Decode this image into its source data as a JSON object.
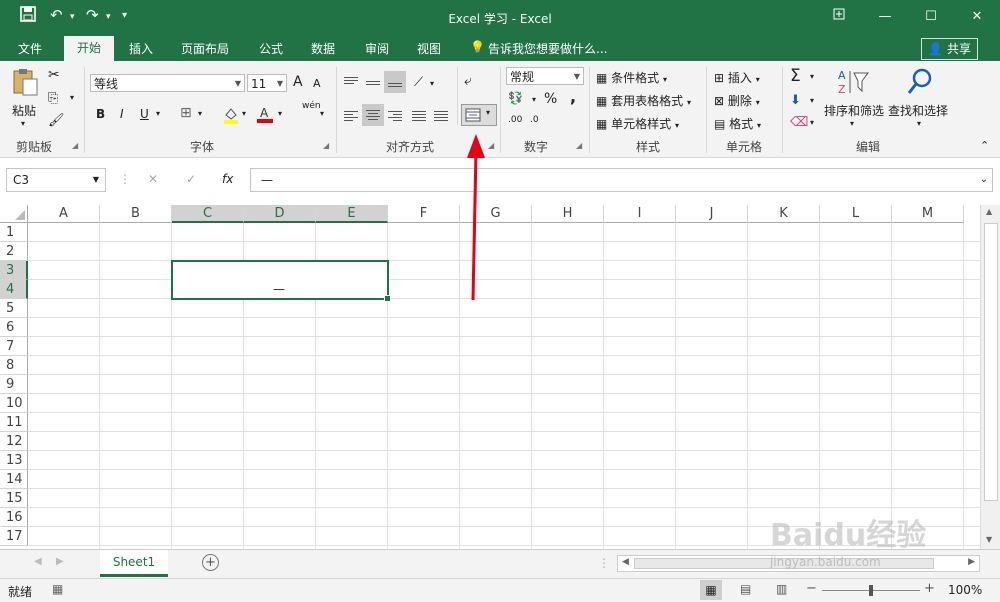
{
  "title_bar": {
    "title": "Excel 学习 - Excel",
    "save_icon": "save-icon",
    "undo_icon": "undo-icon",
    "redo_icon": "redo-icon"
  },
  "tabs": {
    "file": "文件",
    "home": "开始",
    "insert": "插入",
    "page_layout": "页面布局",
    "formulas": "公式",
    "data": "数据",
    "review": "审阅",
    "view": "视图",
    "tell_me": "告诉我您想要做什么...",
    "share": "共享"
  },
  "ribbon": {
    "clipboard": {
      "paste": "粘贴",
      "label": "剪贴板"
    },
    "font": {
      "name": "等线",
      "size": "11",
      "bold": "B",
      "italic": "I",
      "underline": "U",
      "label": "字体",
      "grow": "A",
      "shrink": "A",
      "phonetic": "wén"
    },
    "alignment": {
      "label": "对齐方式"
    },
    "number": {
      "format": "常规",
      "percent": "%",
      "comma": ",",
      "label": "数字",
      "inc_decimal": ".00",
      "dec_decimal": ".0"
    },
    "styles": {
      "conditional": "条件格式",
      "table": "套用表格格式",
      "cell_styles": "单元格样式",
      "label": "样式"
    },
    "cells": {
      "insert": "插入",
      "delete": "删除",
      "format": "格式",
      "label": "单元格"
    },
    "editing": {
      "sigma": "Σ",
      "sort_filter": "排序和筛选",
      "find_select": "查找和选择",
      "label": "编辑"
    }
  },
  "formula_bar": {
    "name_box": "C3",
    "formula": "—",
    "cancel": "✕",
    "enter": "✓",
    "fx": "fx"
  },
  "grid": {
    "columns": [
      "A",
      "B",
      "C",
      "D",
      "E",
      "F",
      "G",
      "H",
      "I",
      "J",
      "K",
      "L",
      "M"
    ],
    "rows": [
      "1",
      "2",
      "3",
      "4",
      "5",
      "6",
      "7",
      "8",
      "9",
      "10",
      "11",
      "12",
      "13",
      "14",
      "15",
      "16",
      "17"
    ],
    "merged_cell_value": "—"
  },
  "sheets": {
    "active": "Sheet1",
    "add": "+"
  },
  "status": {
    "ready": "就绪",
    "zoom": "100%",
    "minus": "−",
    "plus": "+"
  },
  "watermark": {
    "text": "Baidu经验",
    "url": "jingyan.baidu.com"
  },
  "colors": {
    "accent": "#217346",
    "arrow": "#e60012"
  }
}
